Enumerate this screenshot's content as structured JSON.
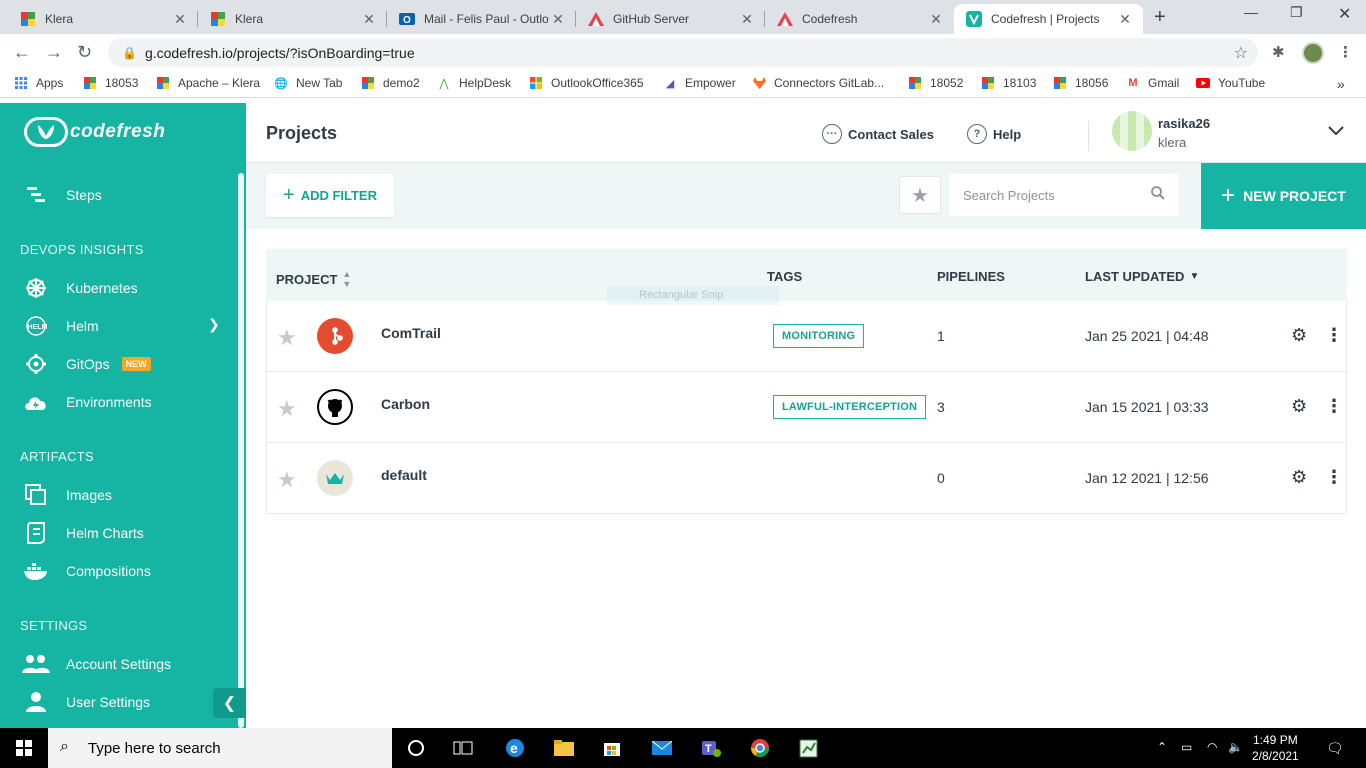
{
  "browser": {
    "tabs": [
      {
        "title": "Klera",
        "favicon": "klera-icon"
      },
      {
        "title": "Klera",
        "favicon": "klera-icon"
      },
      {
        "title": "Mail - Felis Paul - Outlo",
        "favicon": "outlook-icon"
      },
      {
        "title": "GitHub Server",
        "favicon": "codefresh-red-icon"
      },
      {
        "title": "Codefresh",
        "favicon": "codefresh-red-icon"
      },
      {
        "title": "Codefresh | Projects",
        "favicon": "codefresh-teal-icon"
      }
    ],
    "url": "g.codefresh.io/projects/?isOnBoarding=true",
    "bookmarks": [
      "Apps",
      "18053",
      "Apache – Klera",
      "New Tab",
      "demo2",
      "HelpDesk",
      "OutlookOffice365",
      "Empower",
      "Connectors GitLab...",
      "18052",
      "18103",
      "18056",
      "Gmail",
      "YouTube"
    ]
  },
  "sidebar": {
    "logo_text": "codefresh",
    "steps_label": "Steps",
    "section_devops": "DEVOPS INSIGHTS",
    "kubernetes_label": "Kubernetes",
    "helm_label": "Helm",
    "gitops_label": "GitOps",
    "gitops_badge": "NEW",
    "environments_label": "Environments",
    "section_artifacts": "ARTIFACTS",
    "images_label": "Images",
    "helm_charts_label": "Helm Charts",
    "compositions_label": "Compositions",
    "section_settings": "SETTINGS",
    "account_settings_label": "Account Settings",
    "user_settings_label": "User Settings"
  },
  "header": {
    "title": "Projects",
    "contact_sales": "Contact Sales",
    "help": "Help",
    "user_name": "rasika26",
    "account_name": "klera"
  },
  "filterbar": {
    "add_filter_label": "ADD FILTER",
    "search_placeholder": "Search Projects",
    "new_project_label": "NEW PROJECT"
  },
  "table": {
    "columns": {
      "project": "PROJECT",
      "tags": "TAGS",
      "pipelines": "PIPELINES",
      "last_updated": "LAST UPDATED"
    },
    "rows": [
      {
        "name": "ComTrail",
        "tag": "MONITORING",
        "pipelines": "1",
        "updated": "Jan 25 2021 | 04:48",
        "logo": "git-icon",
        "logo_color": "#e44c30"
      },
      {
        "name": "Carbon",
        "tag": "LAWFUL-INTERCEPTION",
        "pipelines": "3",
        "updated": "Jan 15 2021 | 03:33",
        "logo": "github-icon",
        "logo_color": "#000000"
      },
      {
        "name": "default",
        "tag": "",
        "pipelines": "0",
        "updated": "Jan 12 2021 | 12:56",
        "logo": "crown-icon",
        "logo_color": "#e8e6d9"
      }
    ]
  },
  "snip_overlay": "Rectangular Snip",
  "taskbar": {
    "search_placeholder": "Type here to search",
    "time": "1:49 PM",
    "date": "2/8/2021"
  },
  "colors": {
    "brand_teal": "#15b4a3",
    "light_teal_bg": "#eef7f6",
    "badge_orange": "#f5a623"
  }
}
